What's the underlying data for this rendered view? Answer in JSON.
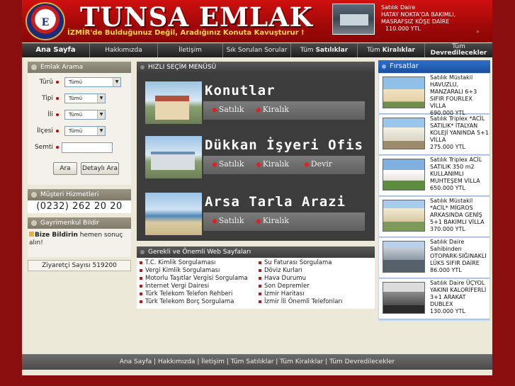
{
  "header": {
    "brand": "TUNSA EMLAK",
    "logo_text": "E",
    "slogan": "İZMİR'de  Bulduğunuz Değil, Aradığınız Konuta Kavuşturur !",
    "promo": {
      "line1": "Satılık Daire",
      "line2": "HATAY NOKTA'DA BAKIMLI,",
      "line3": "MASRAFSIZ KÖŞE DAİRE",
      "price": "110.000 YTL",
      "arrow": "»"
    }
  },
  "nav": {
    "items": [
      "Ana Sayfa",
      "Hakkımızda",
      "İletişim",
      "Sık Sorulan Sorular"
    ],
    "all_sale_prefix": "Tüm",
    "all_sale_bold": "Satılıklar",
    "all_rent_prefix": "Tüm",
    "all_rent_bold": "Kiralıklar",
    "all_transfer_prefix": "Tüm",
    "all_transfer_bold": "Devredilecekler"
  },
  "search": {
    "title": "Emlak Arama",
    "labels": [
      "Türü",
      "Tipi",
      "İli",
      "İlçesi",
      "Semti"
    ],
    "values": [
      "Tümü",
      "Tümü",
      "Tümü",
      "Tümü"
    ],
    "semti_value": "",
    "search_button": "Ara",
    "detailed_button": "Detaylı Ara"
  },
  "customer_service": {
    "title": "Müşteri Hizmetleri",
    "phone": "(0232) 262 20 20"
  },
  "notify": {
    "title": "Gayrimenkul Bildir",
    "bold": "Bize Bildirin",
    "text": " hemen sonuç alın!"
  },
  "counter": {
    "label": "Ziyaretçi Sayısı 519200"
  },
  "quick_menu": {
    "title": "HIZLI SEÇİM MENÜSÜ",
    "rows": [
      {
        "title": "Konutlar",
        "links": [
          "Satılık",
          "Kiralık"
        ]
      },
      {
        "title": "Dükkan İşyeri Ofis",
        "links": [
          "Satılık",
          "Kiralık",
          "Devir"
        ]
      },
      {
        "title": "Arsa Tarla Arazi",
        "links": [
          "Satılık",
          "Kiralık"
        ]
      }
    ]
  },
  "web_pages": {
    "title": "Gerekli ve Önemli Web Sayfaları",
    "left": [
      "T.C. Kimlik Sorgulaması",
      "Vergi Kimlik Sorgulaması",
      "Motorlu Taşıtlar Vergisi Sorgulama",
      "İnternet Vergi Dairesi",
      "Türk Telekom Telefon Rehberi",
      "Türk Telekom  Borç Sorgulama"
    ],
    "right": [
      "Su Faturası Sorgulama",
      "Döviz Kurları",
      "Hava Durumu",
      "Son Depremler",
      "İzmir Haritası",
      "İzmir İli Önemli Telefonları"
    ]
  },
  "opportunities": {
    "title": "Fırsatlar",
    "items": [
      {
        "text": "Satılık Müstakil HAVUZLU, MANZARALI 6+3 SIFIR FOURLEX VİLLA",
        "price": "690.000 YTL"
      },
      {
        "text": "Satılık Triplex *ACİL SATILIK* İTALYAN KOLEJİ YANINDA 5+1 VİLLA",
        "price": "275.000 YTL"
      },
      {
        "text": "Satılık Triplex ACİL SATILIK 350 m2 KULLANIMLI MUHTEŞEM VİLLA",
        "price": "650.000 YTL"
      },
      {
        "text": "Satılık Müstakil *ACİL* MİGROS ARKASINDA GENİŞ 5+1 BAKIMLI VİLLA",
        "price": "370.000 YTL"
      },
      {
        "text": "Satılık Daire Sahibinden OTOPARK-SIĞINAKLI LÜKS SIFIR DAİRE",
        "price": "86.000 YTL"
      },
      {
        "text": "Satılık Daire ÜÇYOL YAKINI KALORİFERLİ 3+1 ARAKAT DUBLEX",
        "price": "130.000 YTL"
      }
    ]
  },
  "footer": {
    "text": "Ana Sayfa | Hakkımızda | İletişim | Tüm Satılıklar | Tüm Kiralıklar | Tüm Devredilecekler"
  }
}
